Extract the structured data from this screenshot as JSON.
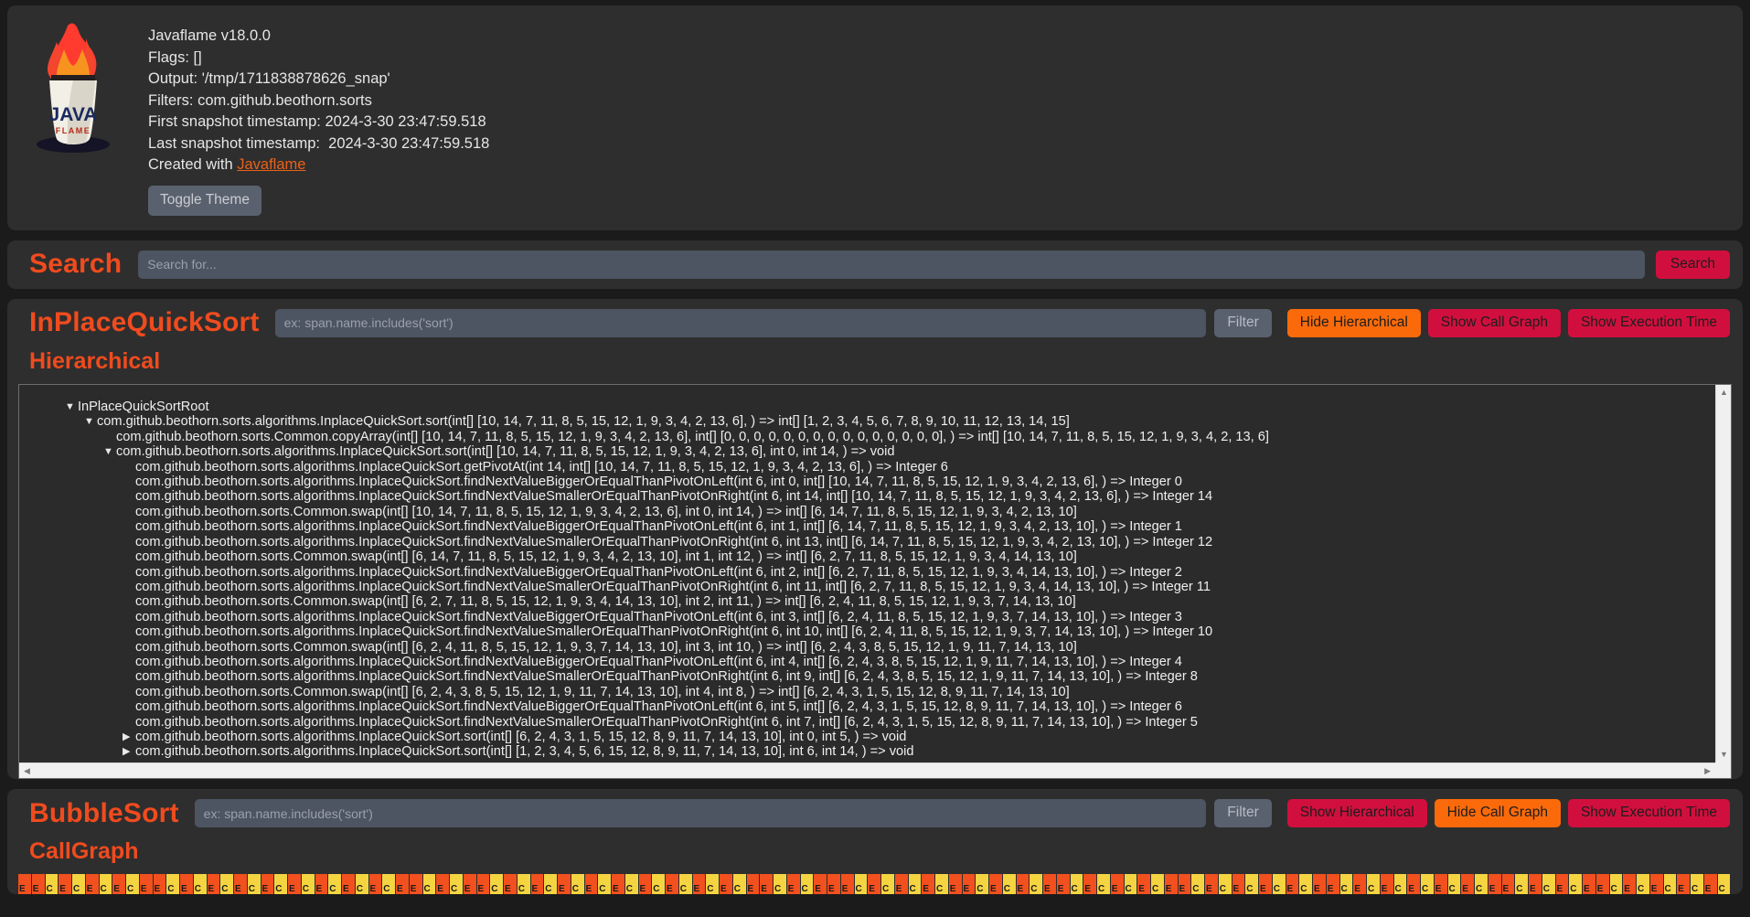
{
  "header": {
    "logo_alt": "java-flame-logo",
    "lines": [
      "Javaflame v18.0.0",
      "Flags: []",
      "Output: '/tmp/1711838878626_snap'",
      "Filters: com.github.beothorn.sorts",
      "First snapshot timestamp: 2024-3-30 23:47:59.518",
      "Last snapshot timestamp:  2024-3-30 23:47:59.518"
    ],
    "created_with_prefix": "Created with ",
    "created_with_link": "Javaflame",
    "toggle_theme_label": "Toggle Theme"
  },
  "search": {
    "title": "Search",
    "placeholder": "Search for...",
    "value": "",
    "button_label": "Search"
  },
  "sections": [
    {
      "title": "InPlaceQuickSort",
      "filter_placeholder": "ex: span.name.includes('sort')",
      "filter_value": "",
      "filter_button": "Filter",
      "buttons": [
        {
          "label": "Hide Hierarchical",
          "style": "orange"
        },
        {
          "label": "Show Call Graph",
          "style": "crimson"
        },
        {
          "label": "Show Execution Time",
          "style": "crimson"
        }
      ],
      "sub_title": "Hierarchical",
      "tree": [
        {
          "indent": 0,
          "toggle": "open",
          "text": "InPlaceQuickSortRoot"
        },
        {
          "indent": 1,
          "toggle": "open",
          "text": "com.github.beothorn.sorts.algorithms.InplaceQuickSort.sort(int[] [10, 14, 7, 11, 8, 5, 15, 12, 1, 9, 3, 4, 2, 13, 6], ) => int[] [1, 2, 3, 4, 5, 6, 7, 8, 9, 10, 11, 12, 13, 14, 15]"
        },
        {
          "indent": 2,
          "toggle": "none",
          "text": "com.github.beothorn.sorts.Common.copyArray(int[] [10, 14, 7, 11, 8, 5, 15, 12, 1, 9, 3, 4, 2, 13, 6], int[] [0, 0, 0, 0, 0, 0, 0, 0, 0, 0, 0, 0, 0, 0, 0], ) => int[] [10, 14, 7, 11, 8, 5, 15, 12, 1, 9, 3, 4, 2, 13, 6]"
        },
        {
          "indent": 2,
          "toggle": "open",
          "text": "com.github.beothorn.sorts.algorithms.InplaceQuickSort.sort(int[] [10, 14, 7, 11, 8, 5, 15, 12, 1, 9, 3, 4, 2, 13, 6], int 0, int 14, ) => void"
        },
        {
          "indent": 3,
          "toggle": "none",
          "text": "com.github.beothorn.sorts.algorithms.InplaceQuickSort.getPivotAt(int 14, int[] [10, 14, 7, 11, 8, 5, 15, 12, 1, 9, 3, 4, 2, 13, 6], ) => Integer 6"
        },
        {
          "indent": 3,
          "toggle": "none",
          "text": "com.github.beothorn.sorts.algorithms.InplaceQuickSort.findNextValueBiggerOrEqualThanPivotOnLeft(int 6, int 0, int[] [10, 14, 7, 11, 8, 5, 15, 12, 1, 9, 3, 4, 2, 13, 6], ) => Integer 0"
        },
        {
          "indent": 3,
          "toggle": "none",
          "text": "com.github.beothorn.sorts.algorithms.InplaceQuickSort.findNextValueSmallerOrEqualThanPivotOnRight(int 6, int 14, int[] [10, 14, 7, 11, 8, 5, 15, 12, 1, 9, 3, 4, 2, 13, 6], ) => Integer 14"
        },
        {
          "indent": 3,
          "toggle": "none",
          "text": "com.github.beothorn.sorts.Common.swap(int[] [10, 14, 7, 11, 8, 5, 15, 12, 1, 9, 3, 4, 2, 13, 6], int 0, int 14, ) => int[] [6, 14, 7, 11, 8, 5, 15, 12, 1, 9, 3, 4, 2, 13, 10]"
        },
        {
          "indent": 3,
          "toggle": "none",
          "text": "com.github.beothorn.sorts.algorithms.InplaceQuickSort.findNextValueBiggerOrEqualThanPivotOnLeft(int 6, int 1, int[] [6, 14, 7, 11, 8, 5, 15, 12, 1, 9, 3, 4, 2, 13, 10], ) => Integer 1"
        },
        {
          "indent": 3,
          "toggle": "none",
          "text": "com.github.beothorn.sorts.algorithms.InplaceQuickSort.findNextValueSmallerOrEqualThanPivotOnRight(int 6, int 13, int[] [6, 14, 7, 11, 8, 5, 15, 12, 1, 9, 3, 4, 2, 13, 10], ) => Integer 12"
        },
        {
          "indent": 3,
          "toggle": "none",
          "text": "com.github.beothorn.sorts.Common.swap(int[] [6, 14, 7, 11, 8, 5, 15, 12, 1, 9, 3, 4, 2, 13, 10], int 1, int 12, ) => int[] [6, 2, 7, 11, 8, 5, 15, 12, 1, 9, 3, 4, 14, 13, 10]"
        },
        {
          "indent": 3,
          "toggle": "none",
          "text": "com.github.beothorn.sorts.algorithms.InplaceQuickSort.findNextValueBiggerOrEqualThanPivotOnLeft(int 6, int 2, int[] [6, 2, 7, 11, 8, 5, 15, 12, 1, 9, 3, 4, 14, 13, 10], ) => Integer 2"
        },
        {
          "indent": 3,
          "toggle": "none",
          "text": "com.github.beothorn.sorts.algorithms.InplaceQuickSort.findNextValueSmallerOrEqualThanPivotOnRight(int 6, int 11, int[] [6, 2, 7, 11, 8, 5, 15, 12, 1, 9, 3, 4, 14, 13, 10], ) => Integer 11"
        },
        {
          "indent": 3,
          "toggle": "none",
          "text": "com.github.beothorn.sorts.Common.swap(int[] [6, 2, 7, 11, 8, 5, 15, 12, 1, 9, 3, 4, 14, 13, 10], int 2, int 11, ) => int[] [6, 2, 4, 11, 8, 5, 15, 12, 1, 9, 3, 7, 14, 13, 10]"
        },
        {
          "indent": 3,
          "toggle": "none",
          "text": "com.github.beothorn.sorts.algorithms.InplaceQuickSort.findNextValueBiggerOrEqualThanPivotOnLeft(int 6, int 3, int[] [6, 2, 4, 11, 8, 5, 15, 12, 1, 9, 3, 7, 14, 13, 10], ) => Integer 3"
        },
        {
          "indent": 3,
          "toggle": "none",
          "text": "com.github.beothorn.sorts.algorithms.InplaceQuickSort.findNextValueSmallerOrEqualThanPivotOnRight(int 6, int 10, int[] [6, 2, 4, 11, 8, 5, 15, 12, 1, 9, 3, 7, 14, 13, 10], ) => Integer 10"
        },
        {
          "indent": 3,
          "toggle": "none",
          "text": "com.github.beothorn.sorts.Common.swap(int[] [6, 2, 4, 11, 8, 5, 15, 12, 1, 9, 3, 7, 14, 13, 10], int 3, int 10, ) => int[] [6, 2, 4, 3, 8, 5, 15, 12, 1, 9, 11, 7, 14, 13, 10]"
        },
        {
          "indent": 3,
          "toggle": "none",
          "text": "com.github.beothorn.sorts.algorithms.InplaceQuickSort.findNextValueBiggerOrEqualThanPivotOnLeft(int 6, int 4, int[] [6, 2, 4, 3, 8, 5, 15, 12, 1, 9, 11, 7, 14, 13, 10], ) => Integer 4"
        },
        {
          "indent": 3,
          "toggle": "none",
          "text": "com.github.beothorn.sorts.algorithms.InplaceQuickSort.findNextValueSmallerOrEqualThanPivotOnRight(int 6, int 9, int[] [6, 2, 4, 3, 8, 5, 15, 12, 1, 9, 11, 7, 14, 13, 10], ) => Integer 8"
        },
        {
          "indent": 3,
          "toggle": "none",
          "text": "com.github.beothorn.sorts.Common.swap(int[] [6, 2, 4, 3, 8, 5, 15, 12, 1, 9, 11, 7, 14, 13, 10], int 4, int 8, ) => int[] [6, 2, 4, 3, 1, 5, 15, 12, 8, 9, 11, 7, 14, 13, 10]"
        },
        {
          "indent": 3,
          "toggle": "none",
          "text": "com.github.beothorn.sorts.algorithms.InplaceQuickSort.findNextValueBiggerOrEqualThanPivotOnLeft(int 6, int 5, int[] [6, 2, 4, 3, 1, 5, 15, 12, 8, 9, 11, 7, 14, 13, 10], ) => Integer 6"
        },
        {
          "indent": 3,
          "toggle": "none",
          "text": "com.github.beothorn.sorts.algorithms.InplaceQuickSort.findNextValueSmallerOrEqualThanPivotOnRight(int 6, int 7, int[] [6, 2, 4, 3, 1, 5, 15, 12, 8, 9, 11, 7, 14, 13, 10], ) => Integer 5"
        },
        {
          "indent": 3,
          "toggle": "closed",
          "text": "com.github.beothorn.sorts.algorithms.InplaceQuickSort.sort(int[] [6, 2, 4, 3, 1, 5, 15, 12, 8, 9, 11, 7, 14, 13, 10], int 0, int 5, ) => void"
        },
        {
          "indent": 3,
          "toggle": "closed",
          "text": "com.github.beothorn.sorts.algorithms.InplaceQuickSort.sort(int[] [1, 2, 3, 4, 5, 6, 15, 12, 8, 9, 11, 7, 14, 13, 10], int 6, int 14, ) => void"
        }
      ]
    },
    {
      "title": "BubbleSort",
      "filter_placeholder": "ex: span.name.includes('sort')",
      "filter_value": "",
      "filter_button": "Filter",
      "buttons": [
        {
          "label": "Show Hierarchical",
          "style": "crimson"
        },
        {
          "label": "Hide Call Graph",
          "style": "orange"
        },
        {
          "label": "Show Execution Time",
          "style": "crimson"
        }
      ],
      "sub_title": "CallGraph",
      "callgraph": {
        "labels": [
          "E",
          "E",
          "C",
          "E",
          "C",
          "E",
          "C",
          "E",
          "C",
          "E",
          "E",
          "C",
          "E",
          "C",
          "E",
          "C",
          "E",
          "C",
          "E",
          "C",
          "E",
          "C",
          "E",
          "C",
          "E",
          "C",
          "E",
          "C",
          "E",
          "E",
          "C",
          "E",
          "C",
          "E",
          "E",
          "C",
          "E",
          "C",
          "E",
          "C",
          "E",
          "C",
          "E",
          "C",
          "E",
          "C",
          "E",
          "C",
          "E",
          "C",
          "E",
          "C",
          "E",
          "C",
          "E",
          "E",
          "C",
          "E",
          "C",
          "E",
          "E",
          "E",
          "C",
          "E",
          "C",
          "E",
          "C",
          "E",
          "C",
          "E",
          "E",
          "C",
          "E",
          "C",
          "E",
          "C",
          "E",
          "E",
          "C",
          "E",
          "C",
          "E",
          "C",
          "E",
          "C",
          "E",
          "E",
          "C",
          "E",
          "C",
          "E",
          "C",
          "E",
          "C",
          "E",
          "C",
          "E",
          "E",
          "C",
          "E",
          "C",
          "E",
          "C",
          "E",
          "C",
          "E",
          "C",
          "E",
          "C",
          "E",
          "E",
          "C",
          "E",
          "C",
          "E",
          "C",
          "E",
          "E",
          "C",
          "E",
          "C",
          "E",
          "C",
          "E",
          "C",
          "E",
          "C"
        ],
        "colors": [
          "#f2501e",
          "#f2501e",
          "#f5d442",
          "#f2501e",
          "#f5d442",
          "#f2501e",
          "#f5d442",
          "#f2501e",
          "#f5d442",
          "#f2501e",
          "#f2501e",
          "#f5d442",
          "#f2501e",
          "#f5d442",
          "#f2501e",
          "#f5d442",
          "#f2501e",
          "#f5d442",
          "#f2501e",
          "#f5d442",
          "#f2501e",
          "#f5d442",
          "#f2501e",
          "#f5d442",
          "#f2501e",
          "#f5d442",
          "#f2501e",
          "#f5d442",
          "#f2501e",
          "#f2501e",
          "#f5d442",
          "#f2501e",
          "#f5d442",
          "#f2501e",
          "#f2501e",
          "#f5d442",
          "#f2501e",
          "#f5d442",
          "#f2501e",
          "#f5d442",
          "#f2501e",
          "#f5d442",
          "#f2501e",
          "#f5d442",
          "#f2501e",
          "#f5d442",
          "#f2501e",
          "#f5d442",
          "#f2501e",
          "#f5d442",
          "#f2501e",
          "#f5d442",
          "#f2501e",
          "#f5d442",
          "#f2501e",
          "#f2501e",
          "#f5d442",
          "#f2501e",
          "#f5d442",
          "#f2501e",
          "#f2501e",
          "#f2501e",
          "#f5d442",
          "#f2501e",
          "#f5d442",
          "#f2501e",
          "#f5d442",
          "#f2501e",
          "#f5d442",
          "#f2501e",
          "#f2501e",
          "#f5d442",
          "#f2501e",
          "#f5d442",
          "#f2501e",
          "#f5d442",
          "#f2501e",
          "#f2501e",
          "#f5d442",
          "#f2501e",
          "#f5d442",
          "#f2501e",
          "#f5d442",
          "#f2501e",
          "#f5d442",
          "#f2501e",
          "#f2501e",
          "#f5d442",
          "#f2501e",
          "#f5d442",
          "#f2501e",
          "#f5d442",
          "#f2501e",
          "#f5d442",
          "#f2501e",
          "#f5d442",
          "#f2501e",
          "#f2501e",
          "#f5d442",
          "#f2501e",
          "#f5d442",
          "#f2501e",
          "#f5d442",
          "#f2501e",
          "#f5d442",
          "#f2501e",
          "#f5d442",
          "#f2501e",
          "#f5d442",
          "#f2501e",
          "#f2501e",
          "#f5d442",
          "#f2501e",
          "#f5d442",
          "#f2501e",
          "#f5d442",
          "#f2501e",
          "#f2501e",
          "#f5d442",
          "#f2501e",
          "#f5d442",
          "#f2501e",
          "#f5d442",
          "#f2501e",
          "#f5d442",
          "#f2501e",
          "#f5d442"
        ]
      }
    }
  ],
  "icons": {
    "triangle_open": "▼",
    "triangle_closed": "▶",
    "arrow_up": "▲",
    "arrow_down": "▼",
    "arrow_left": "◀",
    "arrow_right": "▶"
  },
  "theme": {
    "accent": "#f04b1e",
    "crimson": "#d10f3e",
    "orange": "#fb6a0a",
    "panel_bg": "#2e2e2e",
    "page_bg": "#1b1b1b"
  }
}
